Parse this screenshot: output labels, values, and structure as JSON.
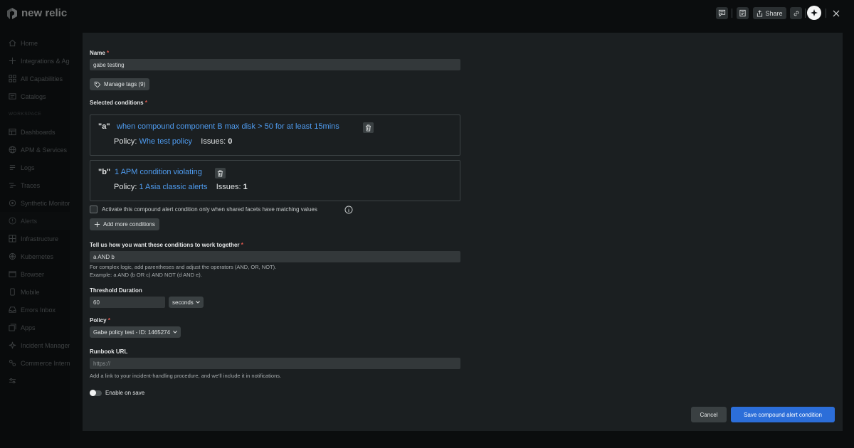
{
  "app": {
    "logo_text": "new relic"
  },
  "sidebar": {
    "items": [
      {
        "label": "Home",
        "icon": "home-icon"
      },
      {
        "label": "Integrations & Agents",
        "icon": "plus-icon"
      },
      {
        "label": "All Capabilities",
        "icon": "grid-icon"
      },
      {
        "label": "Catalogs",
        "icon": "catalog-icon"
      }
    ],
    "section_label": "WORKSPACE",
    "workspace_items": [
      {
        "label": "Dashboards",
        "icon": "dashboard-icon"
      },
      {
        "label": "APM & Services",
        "icon": "globe-icon"
      },
      {
        "label": "Logs",
        "icon": "logs-icon"
      },
      {
        "label": "Traces",
        "icon": "traces-icon"
      },
      {
        "label": "Synthetic Monitoring",
        "icon": "synthetic-icon"
      },
      {
        "label": "Alerts",
        "icon": "alert-icon",
        "active": true
      },
      {
        "label": "Infrastructure",
        "icon": "infrastructure-icon"
      },
      {
        "label": "Kubernetes",
        "icon": "kubernetes-icon"
      },
      {
        "label": "Browser",
        "icon": "browser-icon"
      },
      {
        "label": "Mobile",
        "icon": "mobile-icon"
      },
      {
        "label": "Errors Inbox",
        "icon": "inbox-icon"
      },
      {
        "label": "Apps",
        "icon": "apps-icon"
      },
      {
        "label": "Incident Management",
        "icon": "incident-icon"
      },
      {
        "label": "Commerce Intern",
        "icon": "commerce-icon"
      }
    ]
  },
  "topbar": {
    "share_label": "Share"
  },
  "form": {
    "name_label": "Name",
    "required_mark": "*",
    "name_value": "gabe testing",
    "manage_tags_label": "Manage tags (9)",
    "selected_conditions_label": "Selected conditions",
    "conditions": [
      {
        "key": "\"a\"",
        "title": "when compound component B max disk > 50 for at least 15mins",
        "policy_label": "Policy:",
        "policy_name": "Whe test policy",
        "issues_label": "Issues:",
        "issues_count": "0"
      },
      {
        "key": "\"b\"",
        "title": "1 APM condition violating",
        "policy_label": "Policy:",
        "policy_name": "1 Asia classic alerts",
        "issues_label": "Issues:",
        "issues_count": "1"
      }
    ],
    "facets_checkbox_label": "Activate this compound alert condition only when shared facets have matching values",
    "add_conditions_label": "Add more conditions",
    "logic_label": "Tell us how you want these conditions to work together",
    "logic_value": "a AND b",
    "logic_help_1": "For complex logic, add parentheses and adjust the operators (AND, OR, NOT).",
    "logic_help_2": "Example: a AND (b OR c) AND NOT (d AND e).",
    "threshold_label": "Threshold Duration",
    "threshold_value": "60",
    "threshold_unit": "seconds",
    "policy_label": "Policy",
    "policy_value": "Gabe policy test - ID: 1465274",
    "runbook_label": "Runbook URL",
    "runbook_placeholder": "https://",
    "runbook_help": "Add a link to your incident-handling procedure, and we'll include it in notifications.",
    "enable_on_save_label": "Enable on save",
    "cancel_label": "Cancel",
    "save_label": "Save compound alert condition"
  },
  "colors": {
    "link": "#4f9cf0",
    "primary": "#2c6ed9",
    "required": "#e0584e"
  }
}
